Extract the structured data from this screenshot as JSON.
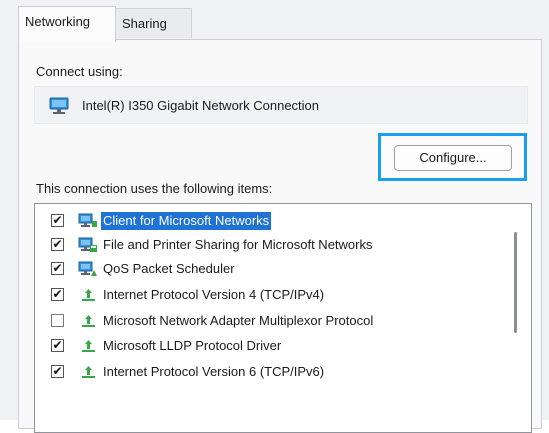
{
  "tabs": [
    {
      "label": "Networking",
      "active": true
    },
    {
      "label": "Sharing",
      "active": false
    }
  ],
  "connect_using_label": "Connect using:",
  "adapter": {
    "name": "Intel(R) I350 Gigabit Network Connection",
    "icon": "network-adapter-icon"
  },
  "configure_button": "Configure...",
  "items_label": "This connection uses the following items:",
  "items": [
    {
      "label": "Client for Microsoft Networks",
      "checked": true,
      "icon": "client-network-icon",
      "selected": true
    },
    {
      "label": "File and Printer Sharing for Microsoft Networks",
      "checked": true,
      "icon": "file-printer-sharing-icon",
      "selected": false
    },
    {
      "label": "QoS Packet Scheduler",
      "checked": true,
      "icon": "qos-scheduler-icon",
      "selected": false
    },
    {
      "label": "Internet Protocol Version 4 (TCP/IPv4)",
      "checked": true,
      "icon": "protocol-icon",
      "selected": false
    },
    {
      "label": "Microsoft Network Adapter Multiplexor Protocol",
      "checked": false,
      "icon": "protocol-icon",
      "selected": false
    },
    {
      "label": "Microsoft LLDP Protocol Driver",
      "checked": true,
      "icon": "protocol-icon",
      "selected": false
    },
    {
      "label": "Internet Protocol Version 6 (TCP/IPv6)",
      "checked": true,
      "icon": "protocol-icon",
      "selected": false
    }
  ],
  "colors": {
    "focus_outline": "#1a9ef0",
    "selection": "#1e73d4",
    "protocol_green": "#3aa64a",
    "monitor_blue": "#2f8fd8"
  }
}
